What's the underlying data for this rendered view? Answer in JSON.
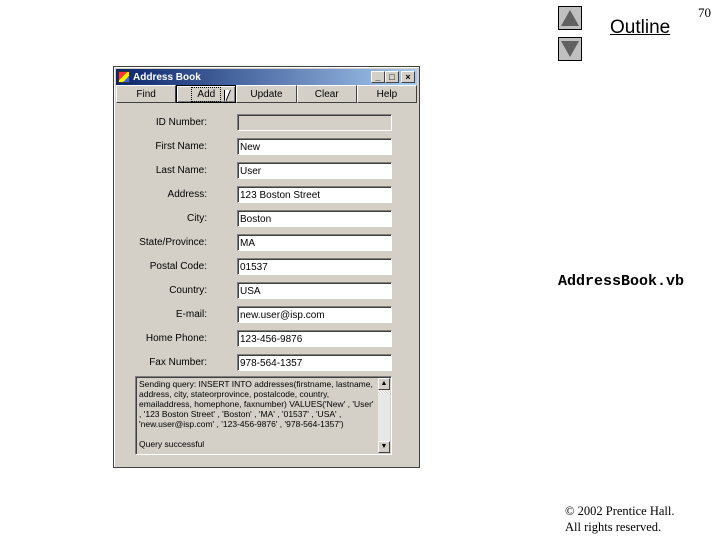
{
  "slide": {
    "outline_label": "Outline",
    "page_number": "70",
    "filename": "AddressBook.vb",
    "copyright_line1": "© 2002 Prentice Hall.",
    "copyright_line2": "All rights reserved.",
    "nav_up_icon": "triangle-up",
    "nav_down_icon": "triangle-down"
  },
  "window": {
    "title": "Address Book",
    "controls": {
      "minimize": "_",
      "maximize": "□",
      "close": "×"
    },
    "toolbar": [
      {
        "label": "Find"
      },
      {
        "label": "Add"
      },
      {
        "label": "Update"
      },
      {
        "label": "Clear"
      },
      {
        "label": "Help"
      }
    ],
    "fields": [
      {
        "label": "ID Number:",
        "value": ""
      },
      {
        "label": "First Name:",
        "value": "New"
      },
      {
        "label": "Last Name:",
        "value": "User"
      },
      {
        "label": "Address:",
        "value": "123 Boston Street"
      },
      {
        "label": "City:",
        "value": "Boston"
      },
      {
        "label": "State/Province:",
        "value": "MA"
      },
      {
        "label": "Postal Code:",
        "value": "01537"
      },
      {
        "label": "Country:",
        "value": "USA"
      },
      {
        "label": "E-mail:",
        "value": "new.user@isp.com"
      },
      {
        "label": "Home Phone:",
        "value": "123-456-9876"
      },
      {
        "label": "Fax Number:",
        "value": "978-564-1357"
      }
    ],
    "log": "Sending query: INSERT INTO addresses(firstname, lastname, address, city, stateorprovince, postalcode, country, emailaddress, homephone, faxnumber) VALUES('New' , 'User' , '123 Boston Street' , 'Boston' , 'MA' , '01537' , 'USA' , 'new.user@isp.com' , '123-456-9876' , '978-564-1357')\n\nQuery successful"
  }
}
